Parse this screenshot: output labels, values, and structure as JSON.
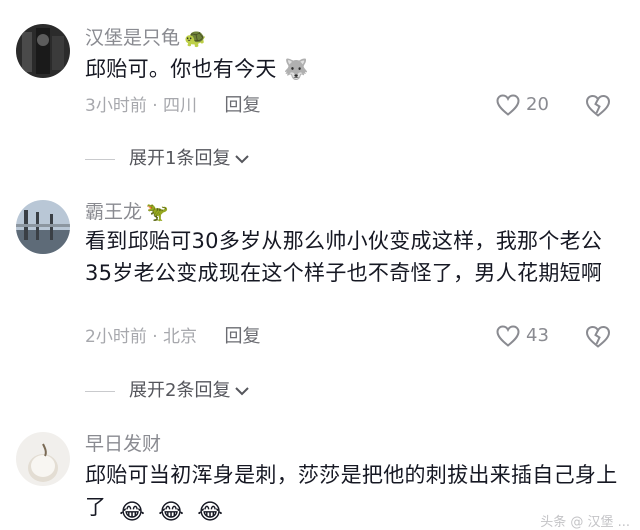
{
  "comments": [
    {
      "username": "汉堡是只龟",
      "name_emoji": "🐢",
      "text": "邱贻可。你也有今天",
      "text_emoji": "🐺",
      "time": "3小时前",
      "location": "四川",
      "reply_label": "回复",
      "likes": "20",
      "expand_label": "展开1条回复"
    },
    {
      "username": "霸王龙",
      "name_emoji": "🦖",
      "text": "看到邱贻可30多岁从那么帅小伙变成这样，我那个老公35岁老公变成现在这个样子也不奇怪了，男人花期短啊",
      "time": "2小时前",
      "location": "北京",
      "reply_label": "回复",
      "likes": "43",
      "expand_label": "展开2条回复"
    },
    {
      "username": "早日发财",
      "text": "邱贻可当初浑身是刺，莎莎是把他的刺拔出来插自己身上了",
      "text_emojis": [
        "😂",
        "😂",
        "😂"
      ]
    }
  ],
  "separator": "·",
  "watermark": "头条 @ 汉堡 ..."
}
